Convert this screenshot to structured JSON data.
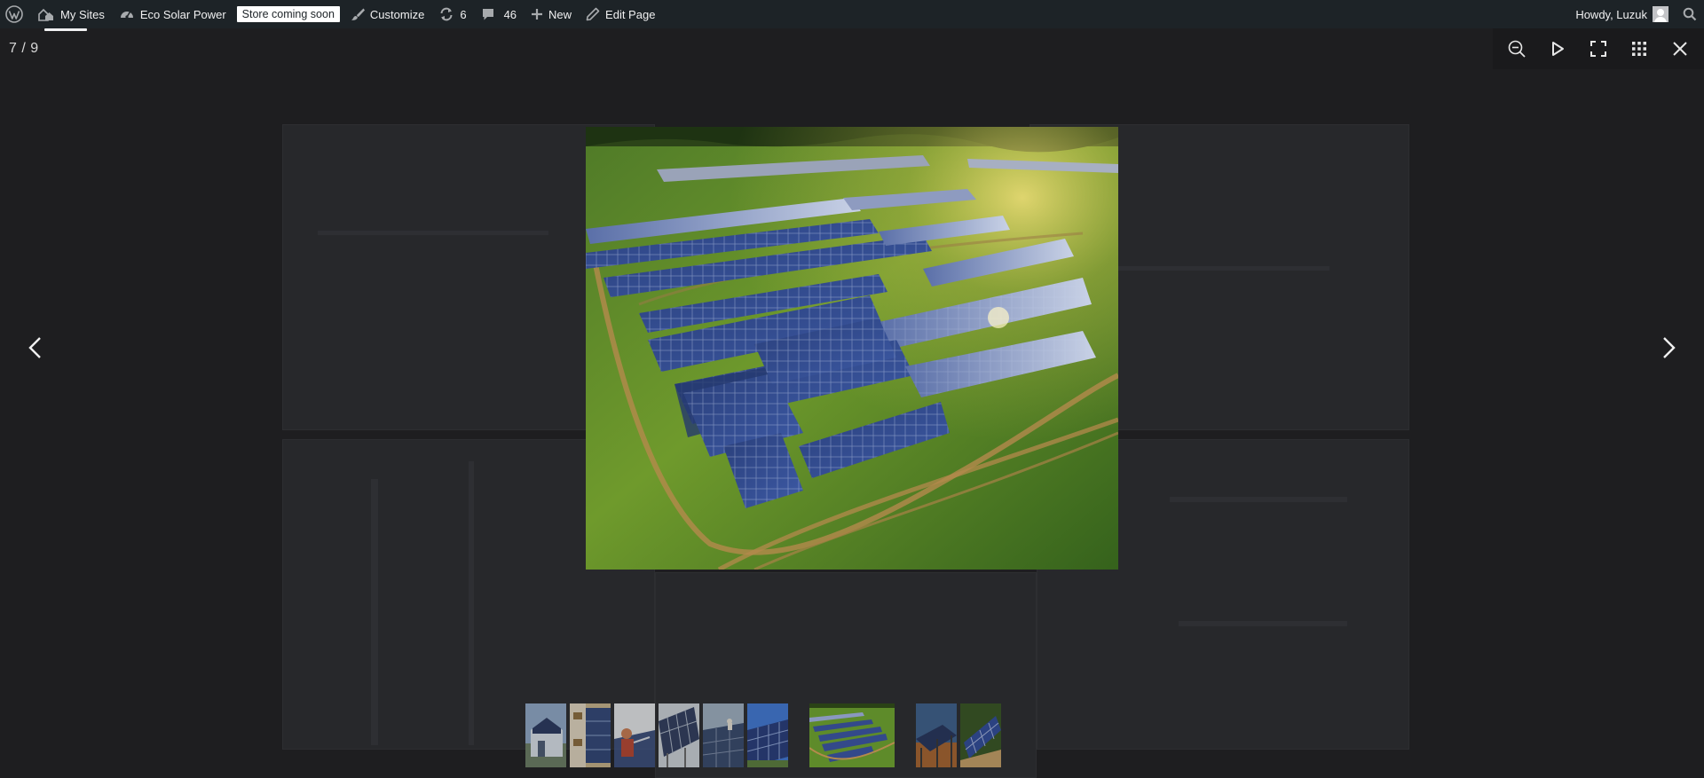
{
  "admin_bar": {
    "wp_logo_icon": "wordpress-logo-icon",
    "my_sites": "My Sites",
    "site_name": "Eco Solar Power",
    "store_badge": "Store coming soon",
    "customize": "Customize",
    "updates_count": "6",
    "comments_count": "46",
    "new_label": "New",
    "edit_page": "Edit Page",
    "howdy": "Howdy, Luzuk"
  },
  "lightbox": {
    "counter": "7 / 9",
    "current_index": 7,
    "total": 9,
    "toolbar_icons": [
      "zoom-out-icon",
      "slideshow-play-icon",
      "fullscreen-icon",
      "thumbnails-grid-icon",
      "close-icon"
    ],
    "thumbnails": [
      {
        "subject": "house with rooftop solar panels"
      },
      {
        "subject": "building facade with solar panels"
      },
      {
        "subject": "worker installing solar panel"
      },
      {
        "subject": "solar panel frame close-up"
      },
      {
        "subject": "workers on rooftop solar array"
      },
      {
        "subject": "solar panels under blue sky"
      },
      {
        "subject": "solar farm in green field"
      },
      {
        "subject": "solar panels at sunset"
      },
      {
        "subject": "solar panels on grass"
      }
    ]
  },
  "colors": {
    "admin_bar_bg": "#1d2327",
    "lightbox_bg": "#1e1e20",
    "toolbar_bg": "#1a1a1c",
    "icon_color": "#e6e6e6"
  }
}
